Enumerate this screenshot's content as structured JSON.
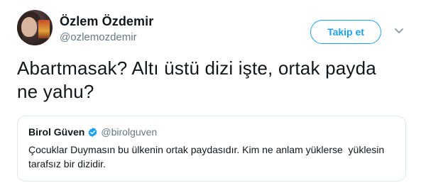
{
  "author": {
    "name": "Özlem Özdemir",
    "handle": "@ozlemozdemir"
  },
  "follow_button": {
    "label": "Takip et"
  },
  "tweet": {
    "lines": [
      "Abartmasak? Altı üstü dizi işte, ortak payda",
      "ne yahu?"
    ]
  },
  "quoted_tweet": {
    "name": "Birol Güven",
    "handle": "@birolguven",
    "lines": [
      "Çocuklar Duymasın bu ülkenin ortak paydasıdır. Kim ne anlam yüklerse  yüklesin",
      "tarafsız bir dizidir."
    ]
  },
  "colors": {
    "accent": "#1da1f2",
    "text": "#14171a",
    "secondary_text": "#657786",
    "border": "#e1e8ed"
  },
  "icons": {
    "verified": "verified-badge-icon",
    "caret": "chevron-down-icon"
  }
}
